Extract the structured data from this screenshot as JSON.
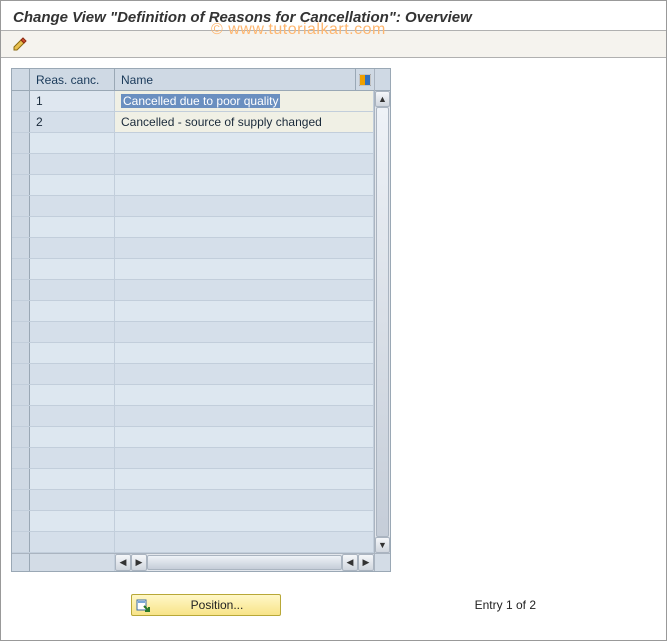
{
  "header": {
    "title": "Change View \"Definition of Reasons for Cancellation\": Overview"
  },
  "watermark": "© www.tutorialkart.com",
  "toolbar": {
    "icons": [
      "edit-icon"
    ]
  },
  "table": {
    "columns": {
      "reas": "Reas. canc.",
      "name": "Name"
    },
    "rows": [
      {
        "reas": "1",
        "name": "Cancelled due to poor quality",
        "selected": true
      },
      {
        "reas": "2",
        "name": "Cancelled - source of supply changed",
        "selected": false
      }
    ],
    "empty_rows": 20
  },
  "footer": {
    "position_label": "Position...",
    "entry_text": "Entry 1 of 2"
  }
}
